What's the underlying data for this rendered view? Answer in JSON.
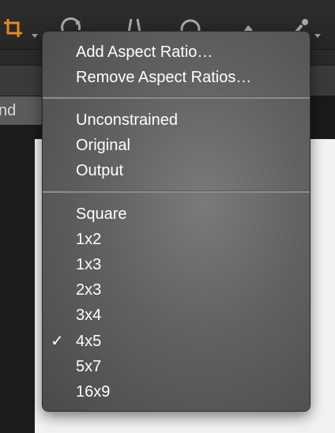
{
  "toolbar": {
    "icons": [
      "crop-icon",
      "rotate-icon",
      "straighten-icon",
      "circle-select-icon",
      "brush-icon",
      "eyedropper-icon"
    ],
    "accent_color": "#e8891e"
  },
  "background": {
    "field_text": "nd"
  },
  "menu": {
    "group1": [
      "Add Aspect Ratio…",
      "Remove Aspect Ratios…"
    ],
    "group2": [
      "Unconstrained",
      "Original",
      "Output"
    ],
    "group3": [
      "Square",
      "1x2",
      "1x3",
      "2x3",
      "3x4",
      "4x5",
      "5x7",
      "16x9"
    ],
    "checked_item": "4x5",
    "check_mark": "✓"
  }
}
